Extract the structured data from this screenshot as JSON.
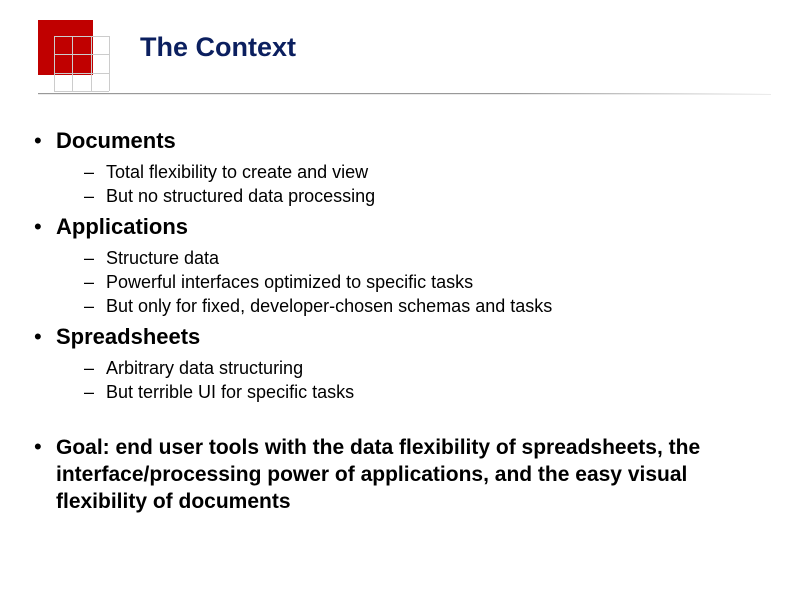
{
  "title": "The Context",
  "items": [
    {
      "label": "Documents",
      "sub": [
        "Total flexibility to create and view",
        "But no structured data processing"
      ]
    },
    {
      "label": "Applications",
      "sub": [
        "Structure data",
        "Powerful interfaces optimized to specific tasks",
        "But only for fixed, developer-chosen schemas and tasks"
      ]
    },
    {
      "label": "Spreadsheets",
      "sub": [
        "Arbitrary data structuring",
        "But terrible UI for specific tasks"
      ]
    }
  ],
  "goal": "Goal: end user tools with the data flexibility of spreadsheets, the interface/processing power of applications, and the easy visual flexibility of documents"
}
